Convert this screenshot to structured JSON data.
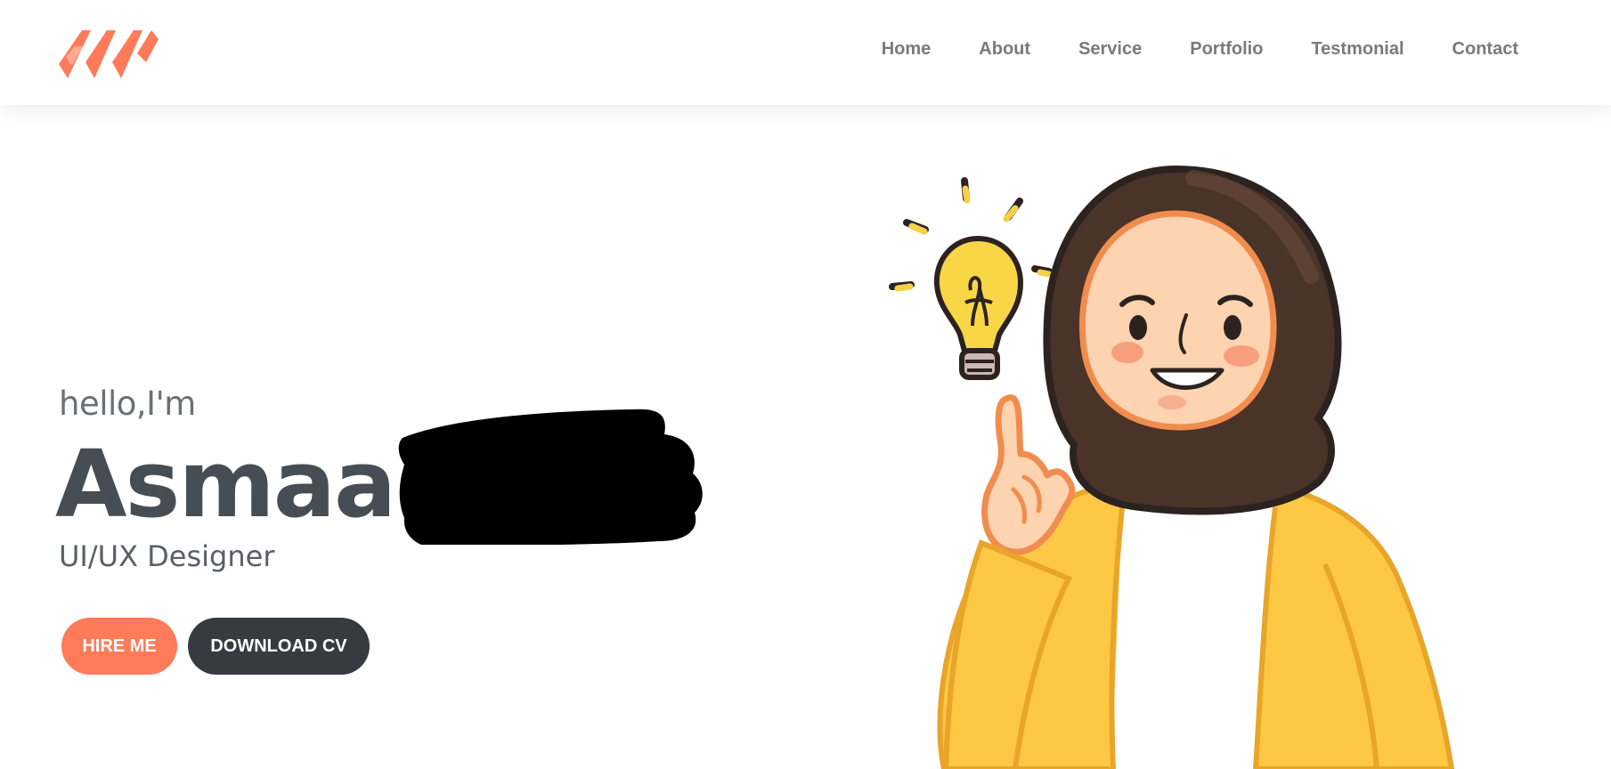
{
  "nav": {
    "items": [
      "Home",
      "About",
      "Service",
      "Portfolio",
      "Testmonial",
      "Contact"
    ]
  },
  "hero": {
    "greeting": "hello,I'm",
    "name": "Asmaa",
    "role": "UI/UX Designer",
    "hire_label": "HIRE ME",
    "cv_label": "DOWNLOAD CV"
  },
  "colors": {
    "accent": "#ff7b5a",
    "dark": "#373b41",
    "text": "#474d55"
  },
  "icons": {
    "logo": "brand-logo-icon",
    "illustration": "hijab-girl-lightbulb-illustration"
  }
}
